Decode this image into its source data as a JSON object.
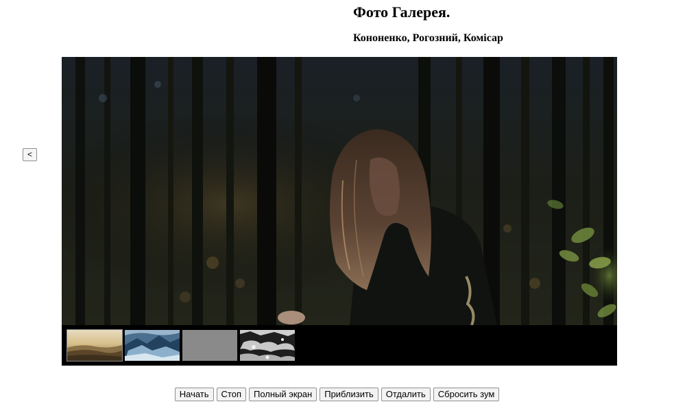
{
  "header": {
    "title": "Фото Галерея.",
    "authors": "Кононенко, Рогозний, Комісар"
  },
  "navigation": {
    "prev_label": "<",
    "next_label": ">"
  },
  "main_photo": {
    "alt": "Long-haired person in a dark forest"
  },
  "thumbnails": [
    {
      "name": "thumbnail-sunset-mountains",
      "active": true
    },
    {
      "name": "thumbnail-blue-mountains",
      "active": false
    },
    {
      "name": "thumbnail-gray",
      "active": false
    },
    {
      "name": "thumbnail-snowy-rocks",
      "active": false
    }
  ],
  "controls": {
    "start": "Начать",
    "stop": "Стоп",
    "fullscreen": "Полный экран",
    "zoom_in": "Приблизить",
    "zoom_out": "Отдалить",
    "reset_zoom": "Сбросить зум"
  },
  "colors": {
    "strip_background": "#000000",
    "page_background": "#ffffff"
  }
}
